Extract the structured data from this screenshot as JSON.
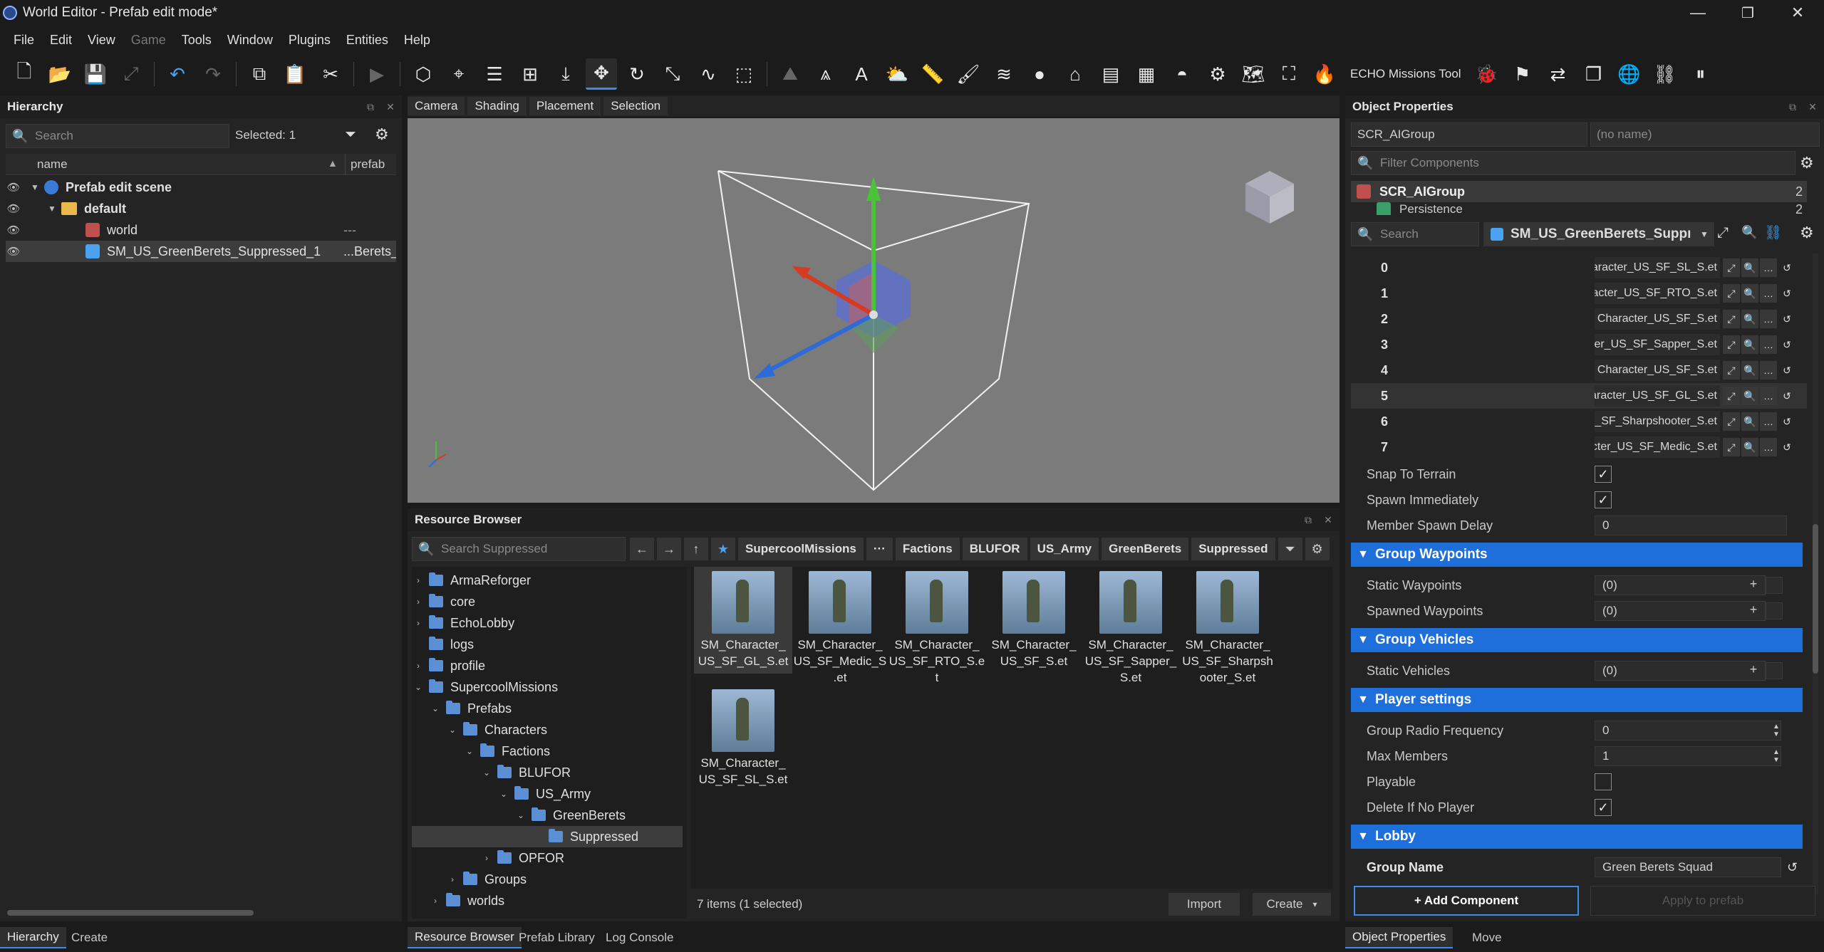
{
  "window": {
    "title": "World Editor - Prefab edit mode*",
    "minimize": "—",
    "maximize": "❐",
    "close": "✕"
  },
  "menu": [
    {
      "label": "File",
      "disabled": false
    },
    {
      "label": "Edit",
      "disabled": false
    },
    {
      "label": "View",
      "disabled": false
    },
    {
      "label": "Game",
      "disabled": true
    },
    {
      "label": "Tools",
      "disabled": false
    },
    {
      "label": "Window",
      "disabled": false
    },
    {
      "label": "Plugins",
      "disabled": false
    },
    {
      "label": "Entities",
      "disabled": false
    },
    {
      "label": "Help",
      "disabled": false
    }
  ],
  "toolbar": {
    "echo_label": "ECHO Missions Tool"
  },
  "hierarchy": {
    "title": "Hierarchy",
    "search_placeholder": "Search",
    "selected": "Selected: 1",
    "col_name": "name",
    "col_prefab": "prefab",
    "rows": [
      {
        "label": "Prefab edit scene",
        "prefab": ""
      },
      {
        "label": "default",
        "prefab": ""
      },
      {
        "label": "world",
        "prefab": "---"
      },
      {
        "label": "SM_US_GreenBerets_Suppressed_1",
        "prefab": "...Berets_S"
      }
    ],
    "tabs": [
      "Hierarchy",
      "Create"
    ]
  },
  "viewport": {
    "tabs": [
      "Camera",
      "Shading",
      "Placement",
      "Selection"
    ]
  },
  "resource_browser": {
    "title": "Resource Browser",
    "search_placeholder": "Search Suppressed",
    "breadcrumb": [
      "SupercoolMissions",
      "···",
      "Factions",
      "BLUFOR",
      "US_Army",
      "GreenBerets",
      "Suppressed"
    ],
    "tree": [
      {
        "label": "ArmaReforger",
        "depth": 0,
        "arrow": "›"
      },
      {
        "label": "core",
        "depth": 0,
        "arrow": "›"
      },
      {
        "label": "EchoLobby",
        "depth": 0,
        "arrow": "›"
      },
      {
        "label": "logs",
        "depth": 0,
        "arrow": ""
      },
      {
        "label": "profile",
        "depth": 0,
        "arrow": "›"
      },
      {
        "label": "SupercoolMissions",
        "depth": 0,
        "arrow": "⌄"
      },
      {
        "label": "Prefabs",
        "depth": 1,
        "arrow": "⌄"
      },
      {
        "label": "Characters",
        "depth": 2,
        "arrow": "⌄"
      },
      {
        "label": "Factions",
        "depth": 3,
        "arrow": "⌄"
      },
      {
        "label": "BLUFOR",
        "depth": 4,
        "arrow": "⌄"
      },
      {
        "label": "US_Army",
        "depth": 5,
        "arrow": "⌄"
      },
      {
        "label": "GreenBerets",
        "depth": 6,
        "arrow": "⌄"
      },
      {
        "label": "Suppressed",
        "depth": 7,
        "arrow": ""
      },
      {
        "label": "OPFOR",
        "depth": 4,
        "arrow": "›"
      },
      {
        "label": "Groups",
        "depth": 2,
        "arrow": "›"
      },
      {
        "label": "worlds",
        "depth": 1,
        "arrow": "›"
      }
    ],
    "files": [
      {
        "line1": "SM_Character_",
        "line2": "US_SF_GL_S.et",
        "line3": ""
      },
      {
        "line1": "SM_Character_",
        "line2": "US_SF_Medic_S",
        "line3": ".et"
      },
      {
        "line1": "SM_Character_",
        "line2": "US_SF_RTO_S.e",
        "line3": "t"
      },
      {
        "line1": "SM_Character_",
        "line2": "US_SF_S.et",
        "line3": ""
      },
      {
        "line1": "SM_Character_",
        "line2": "US_SF_Sapper_",
        "line3": "S.et"
      },
      {
        "line1": "SM_Character_",
        "line2": "US_SF_Sharpsh",
        "line3": "ooter_S.et"
      },
      {
        "line1": "SM_Character_",
        "line2": "US_SF_SL_S.et",
        "line3": ""
      }
    ],
    "status": "7 items (1 selected)",
    "import": "Import",
    "create": "Create",
    "tabs": [
      "Resource Browser",
      "Prefab Library",
      "Log Console"
    ]
  },
  "object_properties": {
    "title": "Object Properties",
    "entity_class": "SCR_AIGroup",
    "entity_name_placeholder": "(no name)",
    "filter_placeholder": "Filter Components",
    "component": "SCR_AIGroup",
    "component_count": "2",
    "sub_component": "Persistence",
    "sub_count": "2",
    "search_placeholder": "Search",
    "prefab_ref": "SM_US_GreenBerets_Suppı",
    "array": [
      {
        "index": "0",
        "value": "Character_US_SF_SL_S.et"
      },
      {
        "index": "1",
        "value": "Character_US_SF_RTO_S.et"
      },
      {
        "index": "2",
        "value": "Character_US_SF_S.et"
      },
      {
        "index": "3",
        "value": "Character_US_SF_Sapper_S.et"
      },
      {
        "index": "4",
        "value": "Character_US_SF_S.et"
      },
      {
        "index": "5",
        "value": "Character_US_SF_GL_S.et"
      },
      {
        "index": "6",
        "value": "US_SF_Sharpshooter_S.et"
      },
      {
        "index": "7",
        "value": "Character_US_SF_Medic_S.et"
      }
    ],
    "snap_to_terrain": "Snap To Terrain",
    "spawn_immediately": "Spawn Immediately",
    "member_spawn_delay": "Member Spawn Delay",
    "member_spawn_delay_value": "0",
    "group_waypoints": "Group Waypoints",
    "static_waypoints": "Static Waypoints",
    "static_waypoints_value": "(0)",
    "spawned_waypoints": "Spawned Waypoints",
    "spawned_waypoints_value": "(0)",
    "group_vehicles": "Group Vehicles",
    "static_vehicles": "Static Vehicles",
    "static_vehicles_value": "(0)",
    "player_settings": "Player settings",
    "group_radio_frequency": "Group Radio Frequency",
    "group_radio_frequency_value": "0",
    "max_members": "Max Members",
    "max_members_value": "1",
    "playable": "Playable",
    "delete_if_no_player": "Delete If No Player",
    "lobby": "Lobby",
    "group_name": "Group Name",
    "group_name_value": "Green Berets Squad",
    "add_component": "+ Add Component",
    "apply_to_prefab": "Apply to prefab",
    "tabs": [
      "Object Properties",
      "Move"
    ]
  },
  "colors": {
    "accent": "#1e6fd9",
    "viewport_bg": "#7b7b7b"
  }
}
